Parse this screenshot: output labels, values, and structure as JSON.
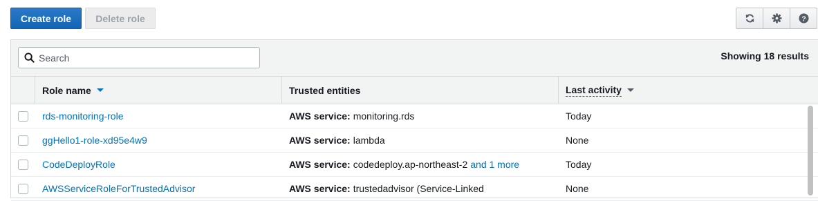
{
  "toolbar": {
    "create_role_label": "Create role",
    "delete_role_label": "Delete role",
    "icons": [
      "refresh-icon",
      "gear-icon",
      "help-icon"
    ]
  },
  "search": {
    "placeholder": "Search",
    "value": ""
  },
  "results_text": "Showing 18 results",
  "table": {
    "columns": [
      "Role name",
      "Trusted entities",
      "Last activity"
    ],
    "rows": [
      {
        "role": "rds-monitoring-role",
        "entity_label": "AWS service:",
        "entity_value": "monitoring.rds",
        "entity_more": "",
        "activity": "Today"
      },
      {
        "role": "ggHello1-role-xd95e4w9",
        "entity_label": "AWS service:",
        "entity_value": "lambda",
        "entity_more": "",
        "activity": "None"
      },
      {
        "role": "CodeDeployRole",
        "entity_label": "AWS service:",
        "entity_value": "codedeploy.ap-northeast-2",
        "entity_more": "and 1 more",
        "activity": "Today"
      },
      {
        "role": "AWSServiceRoleForTrustedAdvisor",
        "entity_label": "AWS service:",
        "entity_value": "trustedadvisor (Service-Linked",
        "entity_more": "",
        "activity": "None"
      }
    ]
  },
  "colors": {
    "primary": "#1165b7",
    "link": "#0073bb",
    "header_bg": "#f2f3f3"
  }
}
